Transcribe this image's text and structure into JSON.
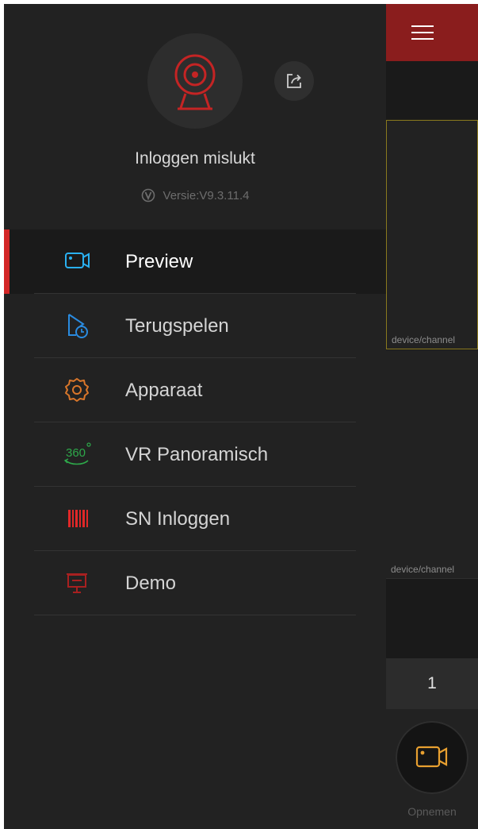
{
  "drawer": {
    "avatar_icon": "webcam-icon",
    "share_icon": "share-icon",
    "login_status": "Inloggen mislukt",
    "version_icon": "version-badge-icon",
    "version": "Versie:V9.3.11.4",
    "active_item": "Preview",
    "menu": [
      {
        "label": "Preview",
        "icon": "camera-icon",
        "color": "#2ab0f0"
      },
      {
        "label": "Terugspelen",
        "icon": "playback-clock-icon",
        "color": "#2a8be0"
      },
      {
        "label": "Apparaat",
        "icon": "gear-icon",
        "color": "#d9762a"
      },
      {
        "label": "VR Panoramisch",
        "icon": "vr-360-icon",
        "color": "#2ea84a"
      },
      {
        "label": "SN Inloggen",
        "icon": "barcode-icon",
        "color": "#e02828"
      },
      {
        "label": "Demo",
        "icon": "presentation-board-icon",
        "color": "#a82020"
      }
    ],
    "accent_color": "#d32626"
  },
  "right_panel": {
    "menu_icon": "hamburger-menu-icon",
    "channels": [
      {
        "label": "device/channel"
      },
      {
        "label": "device/channel"
      }
    ],
    "page_number": "1",
    "record_icon": "record-camera-icon",
    "record_label": "Opnemen",
    "record_icon_color": "#e8a030"
  }
}
